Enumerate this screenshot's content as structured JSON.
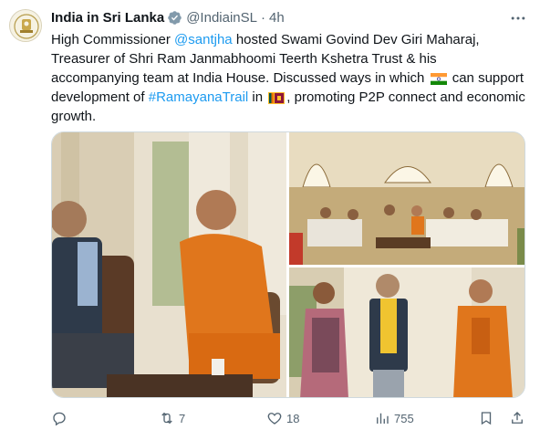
{
  "tweet": {
    "author": {
      "display_name": "India in Sri Lanka",
      "handle": "@IndiainSL",
      "separator": "·",
      "time": "4h",
      "verified_color": "#829aab"
    },
    "text": {
      "p1": "High Commissioner ",
      "mention": "@santjha",
      "p2": " hosted Swami Govind Dev Giri Maharaj, Treasurer of Shri Ram Janmabhoomi Teerth Kshetra Trust & his accompanying team at India House. Discussed ways in which ",
      "p3": " can support development of ",
      "hashtag": "#RamayanaTrail",
      "p4": " in ",
      "p5": ", promoting P2P connect and economic growth.",
      "flag_1": "india-flag-icon",
      "flag_2": "sri-lanka-flag-icon"
    },
    "media": {
      "photos": [
        {
          "description_icon": "photo-meeting-seated"
        },
        {
          "description_icon": "photo-hall-gathering"
        },
        {
          "description_icon": "photo-standing-group"
        }
      ]
    },
    "actions": {
      "reply_count": "",
      "repost_count": "7",
      "like_count": "18",
      "view_count": "755"
    },
    "colors": {
      "link": "#1d9bf0",
      "muted": "#536471",
      "text": "#0f1419"
    }
  }
}
